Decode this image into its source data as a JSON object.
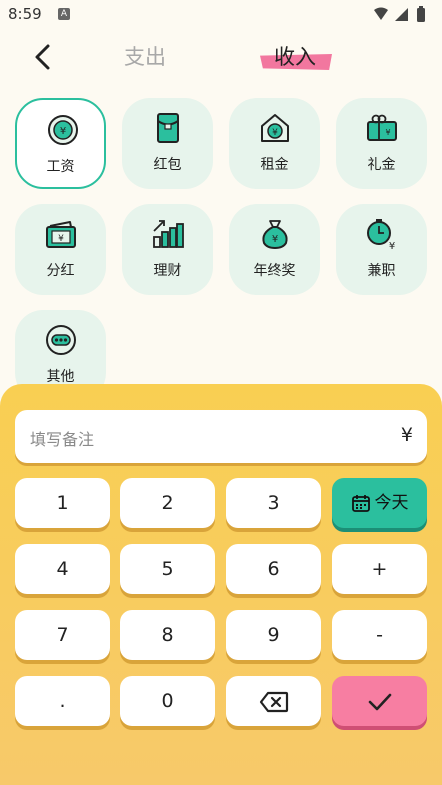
{
  "status_bar": {
    "time": "8:59",
    "notif_icon": "A"
  },
  "header": {
    "tabs": [
      {
        "label": "支出"
      },
      {
        "label": "收入"
      }
    ],
    "active_tab": 1,
    "highlight_color": "#f2779f"
  },
  "categories": [
    {
      "label": "工资",
      "icon": "coin-icon",
      "selected": true
    },
    {
      "label": "红包",
      "icon": "red-envelope-icon"
    },
    {
      "label": "租金",
      "icon": "house-icon"
    },
    {
      "label": "礼金",
      "icon": "gift-icon"
    },
    {
      "label": "分红",
      "icon": "banknote-icon"
    },
    {
      "label": "理财",
      "icon": "bar-growth-icon"
    },
    {
      "label": "年终奖",
      "icon": "money-bag-icon"
    },
    {
      "label": "兼职",
      "icon": "clock-yen-icon"
    },
    {
      "label": "其他",
      "icon": "more-dots-icon"
    }
  ],
  "note": {
    "placeholder": "填写备注",
    "currency": "¥"
  },
  "keypad": {
    "k1": "1",
    "k2": "2",
    "k3": "3",
    "today": "今天",
    "k4": "4",
    "k5": "5",
    "k6": "6",
    "plus": "+",
    "k7": "7",
    "k8": "8",
    "k9": "9",
    "minus": "-",
    "dot": ".",
    "k0": "0"
  },
  "colors": {
    "accent": "#2bbf9e",
    "panel": "#f9cf52",
    "confirm": "#f77ea2",
    "tile": "#e7f4ec"
  }
}
